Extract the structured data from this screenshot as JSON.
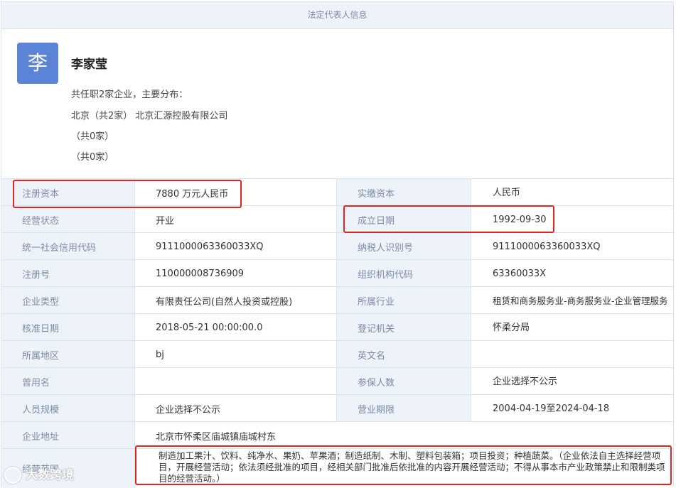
{
  "header": {
    "title": "法定代表人信息"
  },
  "person": {
    "avatar_char": "李",
    "name": "李家莹",
    "summary": "共任职2家企业，主要分布：",
    "lines": [
      "北京（共2家） 北京汇源控股有限公司",
      "（共0家）",
      "（共0家）"
    ]
  },
  "rows": [
    {
      "l1": "注册资本",
      "v1": "7880 万元人民币",
      "l2": "实缴资本",
      "v2": "人民币"
    },
    {
      "l1": "经营状态",
      "v1": "开业",
      "l2": "成立日期",
      "v2": "1992-09-30"
    },
    {
      "l1": "统一社会信用代码",
      "v1": "9111000063360033XQ",
      "l2": "纳税人识别号",
      "v2": "9111000063360033XQ"
    },
    {
      "l1": "注册号",
      "v1": "110000008736909",
      "l2": "组织机构代码",
      "v2": "63360033X"
    },
    {
      "l1": "企业类型",
      "v1": "有限责任公司(自然人投资或控股)",
      "l2": "所属行业",
      "v2": "租赁和商务服务业-商务服务业-企业管理服务"
    },
    {
      "l1": "核准日期",
      "v1": "2018-05-21 00:00:00.0",
      "l2": "登记机关",
      "v2": "怀柔分局"
    },
    {
      "l1": "所属地区",
      "v1": "bj",
      "l2": "英文名",
      "v2": ""
    },
    {
      "l1": "曾用名",
      "v1": "",
      "l2": "参保人数",
      "v2": "企业选择不公示"
    },
    {
      "l1": "人员规模",
      "v1": "企业选择不公示",
      "l2": "营业期限",
      "v2": "2004-04-19至2024-04-18"
    }
  ],
  "address": {
    "label": "企业地址",
    "value": "北京市怀柔区庙城镇庙城村东"
  },
  "scope": {
    "label": "经营范围",
    "value": "制造加工果汁、饮料、纯净水、果奶、苹果酒；制造纸制、木制、塑料包装箱；项目投资；种植蔬菜。（企业依法自主选择经营项目，开展经营活动；依法须经批准的项目，经相关部门批准后依批准的内容开展经营活动；不得从事本市产业政策禁止和限制类项目的经营活动。）"
  },
  "watermark": "大数跨境",
  "colors": {
    "highlight": "#e0261d",
    "avatar": "#5b84d6",
    "label_bg": "#eef3fa"
  }
}
